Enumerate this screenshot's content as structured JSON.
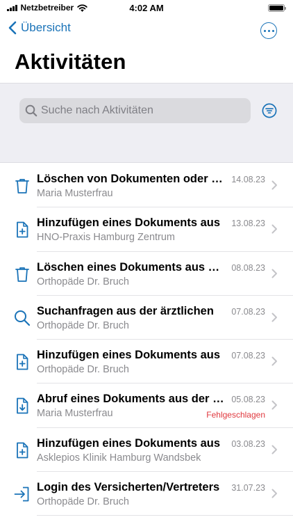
{
  "status_bar": {
    "carrier": "Netzbetreiber",
    "time": "4:02 AM",
    "battery_level": 1.0
  },
  "nav": {
    "back_label": "Übersicht",
    "more_icon": "ellipsis-circle-icon"
  },
  "page": {
    "title": "Aktivitäten"
  },
  "search": {
    "placeholder": "Suche nach Aktivitäten",
    "value": "",
    "filter_icon": "filter-lines-icon"
  },
  "colors": {
    "accent": "#1a73b8",
    "secondary_text": "#8a8a8e",
    "error": "#e0383e",
    "search_band": "#eeeef3"
  },
  "activities": [
    {
      "icon": "trash-icon",
      "title": "Löschen von Dokumenten oder Ordnern",
      "subtitle": "Maria Musterfrau",
      "date": "14.08.23",
      "status": ""
    },
    {
      "icon": "document-add-icon",
      "title": "Hinzufügen eines Dokuments aus",
      "subtitle": "HNO-Praxis Hamburg Zentrum",
      "date": "13.08.23",
      "status": ""
    },
    {
      "icon": "trash-icon",
      "title": "Löschen eines Dokuments aus der",
      "subtitle": "Orthopäde Dr. Bruch",
      "date": "08.08.23",
      "status": ""
    },
    {
      "icon": "search-icon",
      "title": "Suchanfragen aus der ärztlichen",
      "subtitle": "Orthopäde Dr. Bruch",
      "date": "07.08.23",
      "status": ""
    },
    {
      "icon": "document-add-icon",
      "title": "Hinzufügen eines Dokuments aus",
      "subtitle": "Orthopäde Dr. Bruch",
      "date": "07.08.23",
      "status": ""
    },
    {
      "icon": "document-download-icon",
      "title": "Abruf eines Dokuments aus der ePA",
      "subtitle": "Maria Musterfrau",
      "date": "05.08.23",
      "status": "Fehlgeschlagen"
    },
    {
      "icon": "document-add-icon",
      "title": "Hinzufügen eines Dokuments aus",
      "subtitle": "Asklepios Klinik Hamburg Wandsbek",
      "date": "03.08.23",
      "status": ""
    },
    {
      "icon": "login-icon",
      "title": "Login des Versicherten/Vertreters",
      "subtitle": "Orthopäde Dr. Bruch",
      "date": "31.07.23",
      "status": ""
    }
  ]
}
